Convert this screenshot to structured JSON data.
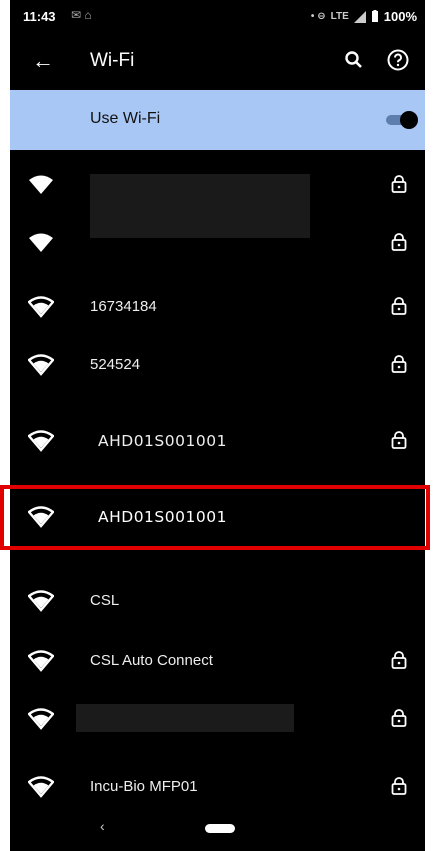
{
  "status_bar": {
    "time": "11:43",
    "left_icons": "✉ ⌂",
    "right_glyphs": "• ⊖",
    "network": "LTE",
    "battery": "100%"
  },
  "app_bar": {
    "title": "Wi-Fi",
    "back_icon": "arrow-back-icon",
    "search_icon": "search-icon",
    "help_icon": "help-icon"
  },
  "use_wifi": {
    "label": "Use Wi-Fi",
    "enabled": true
  },
  "networks": [
    {
      "name": "",
      "redacted": true,
      "secured": true
    },
    {
      "name": "",
      "redacted": false,
      "secured": true
    },
    {
      "name": "16734184",
      "secured": true
    },
    {
      "name": "524524",
      "secured": true
    },
    {
      "name": "AHD01S001001",
      "secured": true
    },
    {
      "name": "AHD01S001001",
      "secured": false,
      "highlighted": true
    },
    {
      "name": "CSL",
      "secured": false
    },
    {
      "name": "CSL Auto Connect",
      "secured": true
    },
    {
      "name": "",
      "redacted": true,
      "secured": true
    },
    {
      "name": "Incu-Bio MFP01",
      "secured": true
    }
  ],
  "nav": {
    "back": "‹"
  },
  "colors": {
    "accent": "#a8c7f5",
    "highlight": "#e00000",
    "background": "#000000"
  }
}
